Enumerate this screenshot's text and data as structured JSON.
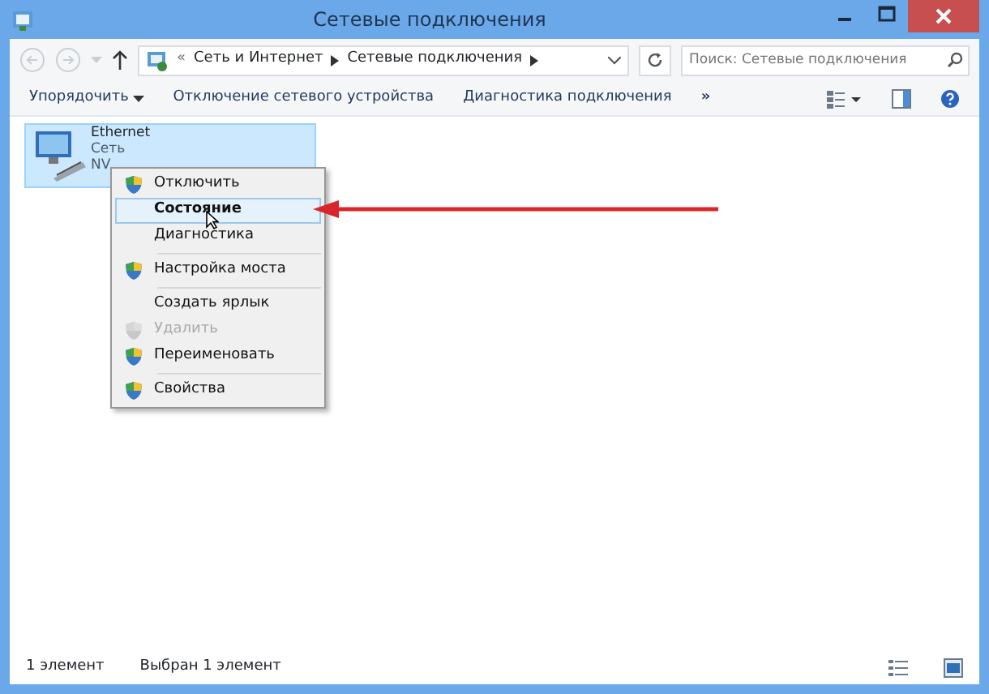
{
  "window": {
    "title": "Сетевые подключения"
  },
  "address": {
    "overflow": "«",
    "crumbs": [
      "Сеть и Интернет",
      "Сетевые подключения"
    ],
    "search_placeholder": "Поиск: Сетевые подключения"
  },
  "toolbar": {
    "items": [
      {
        "label": "Упорядочить",
        "dropdown": true
      },
      {
        "label": "Отключение сетевого устройства",
        "dropdown": false
      },
      {
        "label": "Диагностика подключения",
        "dropdown": false
      }
    ],
    "more": "»"
  },
  "connections": [
    {
      "name": "Ethernet",
      "network": "Сеть",
      "device": "NV",
      "selected": true
    }
  ],
  "context_menu": [
    {
      "kind": "item",
      "label": "Отключить",
      "shield": true,
      "disabled": false,
      "selected": false,
      "bold": false
    },
    {
      "kind": "item",
      "label": "Состояние",
      "shield": false,
      "disabled": false,
      "selected": true,
      "bold": true
    },
    {
      "kind": "item",
      "label": "Диагностика",
      "shield": false,
      "disabled": false,
      "selected": false,
      "bold": false
    },
    {
      "kind": "separator"
    },
    {
      "kind": "item",
      "label": "Настройка моста",
      "shield": true,
      "disabled": false,
      "selected": false,
      "bold": false
    },
    {
      "kind": "separator"
    },
    {
      "kind": "item",
      "label": "Создать ярлык",
      "shield": false,
      "disabled": false,
      "selected": false,
      "bold": false
    },
    {
      "kind": "item",
      "label": "Удалить",
      "shield": true,
      "disabled": true,
      "selected": false,
      "bold": false
    },
    {
      "kind": "item",
      "label": "Переименовать",
      "shield": true,
      "disabled": false,
      "selected": false,
      "bold": false
    },
    {
      "kind": "separator"
    },
    {
      "kind": "item",
      "label": "Свойства",
      "shield": true,
      "disabled": false,
      "selected": false,
      "bold": false
    }
  ],
  "status_bar": {
    "count": "1 элемент",
    "selection": "Выбран 1 элемент"
  }
}
